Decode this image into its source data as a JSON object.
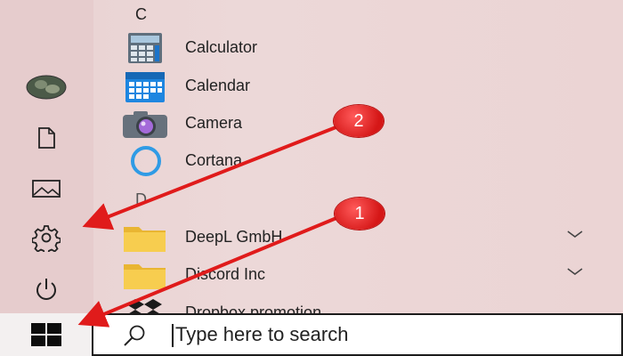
{
  "colors": {
    "annotation_red": "#e01b1b",
    "taskbar_border": "#1c1c1c"
  },
  "start_menu": {
    "letters": [
      "C",
      "D"
    ],
    "apps": [
      {
        "label": "Calculator",
        "icon": "calculator-icon"
      },
      {
        "label": "Calendar",
        "icon": "calendar-icon"
      },
      {
        "label": "Camera",
        "icon": "camera-icon"
      },
      {
        "label": "Cortana",
        "icon": "cortana-icon"
      },
      {
        "label": "DeepL GmbH",
        "icon": "folder-icon",
        "expandable": true
      },
      {
        "label": "Discord Inc",
        "icon": "folder-icon",
        "expandable": true
      },
      {
        "label": "Dropbox promotion",
        "icon": "dropbox-icon"
      }
    ],
    "rail": [
      "avatar",
      "documents-icon",
      "pictures-icon",
      "settings-icon",
      "power-icon"
    ]
  },
  "taskbar": {
    "start_icon": "windows-logo-icon",
    "search_placeholder": "Type here to search",
    "search_icon": "search-icon"
  },
  "annotations": [
    {
      "label": "1"
    },
    {
      "label": "2"
    }
  ]
}
